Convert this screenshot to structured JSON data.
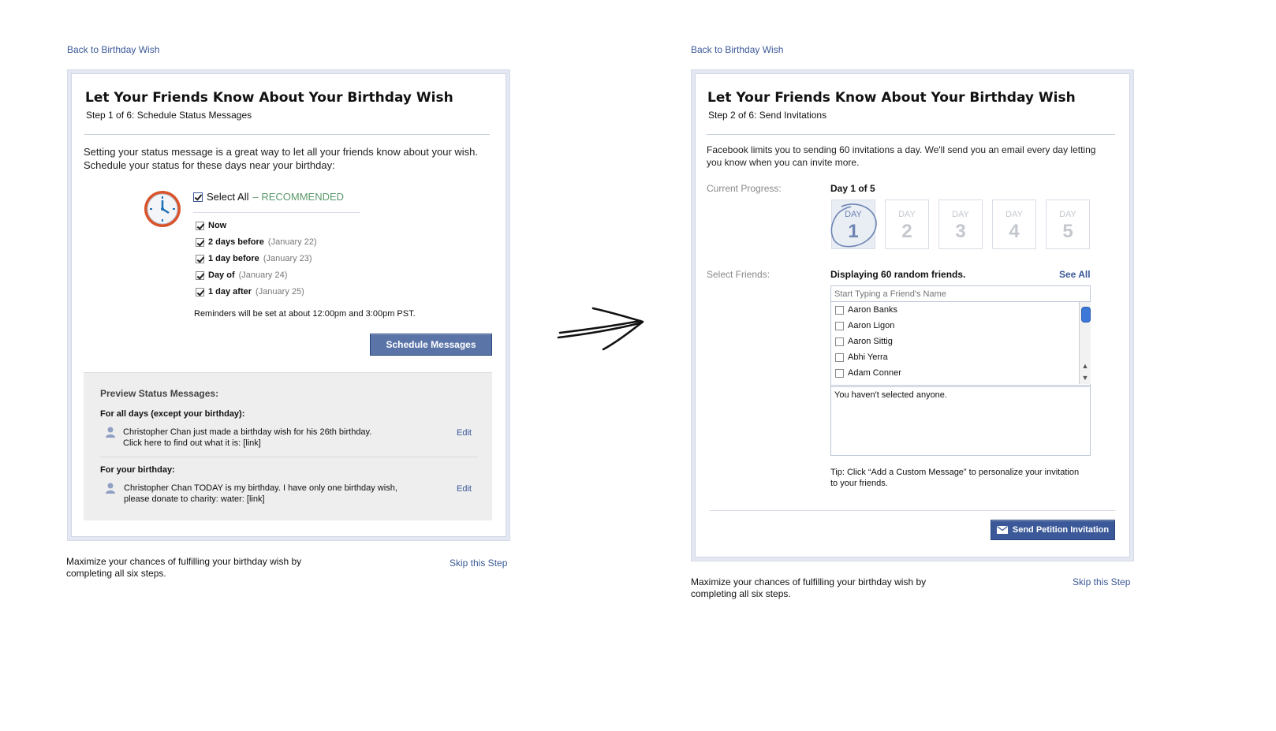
{
  "left": {
    "back_link": "Back to Birthday Wish",
    "title": "Let Your Friends Know About Your Birthday Wish",
    "step": "Step 1 of 6: Schedule Status Messages",
    "intro": "Setting your status message is a great way to let all your friends know about your wish. Schedule your status for these days near your birthday:",
    "select_all": {
      "label": "Select All",
      "tag": "– RECOMMENDED"
    },
    "options": [
      {
        "label": "Now",
        "date": ""
      },
      {
        "label": "2 days before",
        "date": "(January 22)"
      },
      {
        "label": "1 day before",
        "date": "(January 23)"
      },
      {
        "label": "Day of",
        "date": "(January 24)"
      },
      {
        "label": "1 day after",
        "date": "(January 25)"
      }
    ],
    "reminder": "Reminders will be set at about 12:00pm and 3:00pm PST.",
    "schedule_button": "Schedule Messages",
    "preview": {
      "heading": "Preview Status Messages:",
      "all_days_label": "For all days (except your birthday):",
      "all_days_msg_line1": "Christopher Chan just made a birthday wish for his 26th birthday.",
      "all_days_msg_line2": "Click here to find out what it is: [link]",
      "birthday_label": "For your birthday:",
      "birthday_msg_line1": "Christopher Chan TODAY is my birthday. I have only one birthday wish,",
      "birthday_msg_line2": "please donate to charity: water: [link]",
      "edit": "Edit"
    },
    "footer_text_line1": "Maximize your chances of fulfilling your birthday wish by",
    "footer_text_line2": "completing all six steps.",
    "skip": "Skip this Step"
  },
  "right": {
    "back_link": "Back to Birthday Wish",
    "title": "Let Your Friends Know About Your Birthday Wish",
    "step": "Step 2 of 6: Send Invitations",
    "intro": "Facebook limits you to sending 60 invitations a day. We'll send you an email every day letting you know when you can invite more.",
    "progress_label": "Current Progress:",
    "progress_value": "Day 1 of 5",
    "day_label": "DAY",
    "days": [
      "1",
      "2",
      "3",
      "4",
      "5"
    ],
    "current_day": 1,
    "select_label": "Select Friends:",
    "displaying": "Displaying 60 random friends.",
    "see_all": "See All",
    "search_placeholder": "Start Typing a Friend's Name",
    "friends": [
      "Aaron Banks",
      "Aaron Ligon",
      "Aaron Sittig",
      "Abhi Yerra",
      "Adam Conner"
    ],
    "selected_text": "You haven't selected anyone.",
    "tip_line1": "Tip: Click “Add a Custom Message” to personalize your invitation",
    "tip_line2": "to your friends.",
    "send_button": "Send Petition Invitation",
    "footer_text_line1": "Maximize your chances of fulfilling your birthday wish by",
    "footer_text_line2": "completing all six steps.",
    "skip": "Skip this Step"
  },
  "colors": {
    "link": "#3b5998",
    "button": "#5b74a8",
    "recommended": "#5a9a6a",
    "dark_button": "#3b5998"
  },
  "icons": [
    "clock-icon",
    "person-icon",
    "mail-icon",
    "arrow-icon",
    "scroll-up-icon",
    "scroll-down-icon"
  ]
}
